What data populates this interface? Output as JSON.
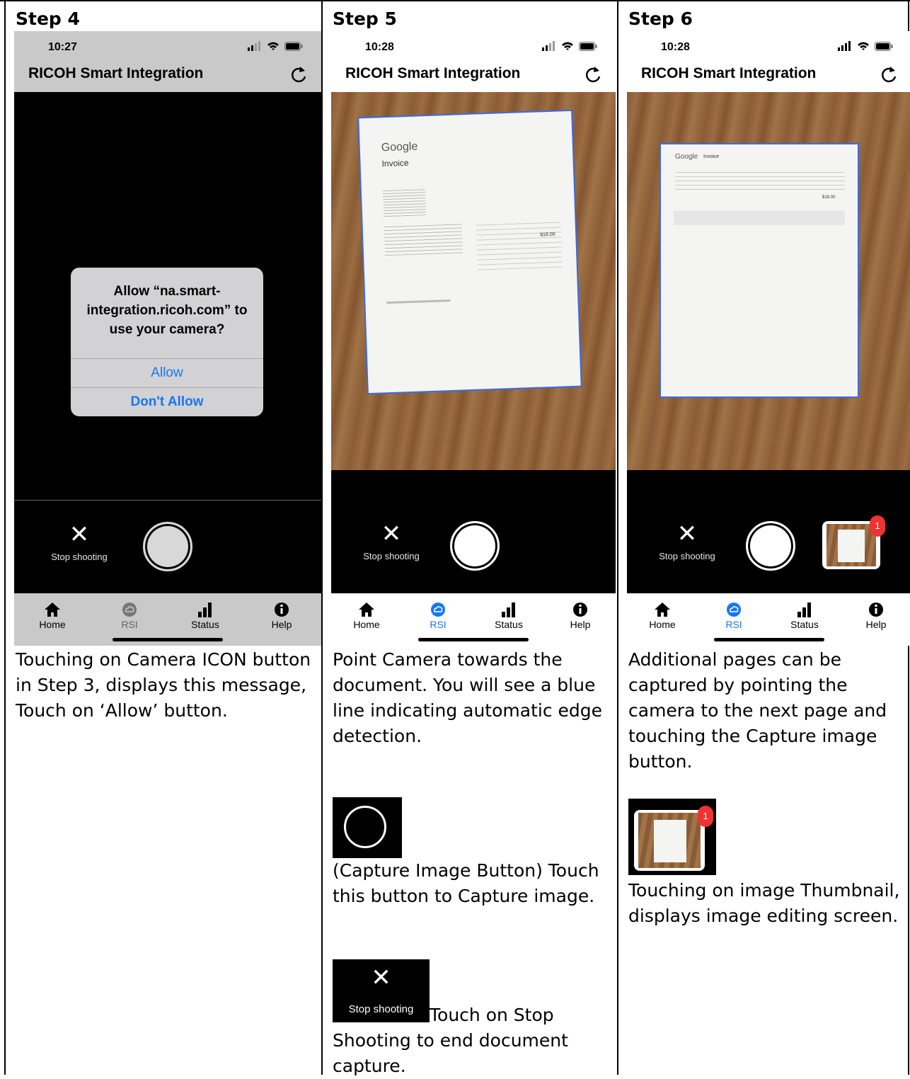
{
  "steps": [
    {
      "heading": "Step 4",
      "time": "10:27",
      "app_title": "RICOH Smart Integration",
      "dialog": {
        "message": "Allow “na.smart-integration.ricoh.com” to use your camera?",
        "allow_label": "Allow",
        "deny_label": "Don't Allow"
      },
      "stop_label": "Stop shooting",
      "tabs": [
        "Home",
        "RSI",
        "Status",
        "Help"
      ],
      "description": "Touching on Camera ICON button in Step 3, displays this message, Touch on ‘Allow’ button."
    },
    {
      "heading": "Step 5",
      "time": "10:28",
      "app_title": "RICOH Smart Integration",
      "document": {
        "brand": "Google",
        "title": "Invoice",
        "total": "$18.00"
      },
      "stop_label": "Stop shooting",
      "tabs": [
        "Home",
        "RSI",
        "Status",
        "Help"
      ],
      "description": "Point Camera towards the document. You will see a blue line indicating automatic edge detection.",
      "capture_caption": "(Capture Image Button) Touch this button to Capture image.",
      "stop_caption": "Touch on Stop Shooting to end document capture."
    },
    {
      "heading": "Step 6",
      "time": "10:28",
      "app_title": "RICOH Smart Integration",
      "document": {
        "brand": "Google",
        "title": "Invoice",
        "total": "$18.00"
      },
      "stop_label": "Stop shooting",
      "tabs": [
        "Home",
        "RSI",
        "Status",
        "Help"
      ],
      "badge": "1",
      "description": "Additional pages can be captured by pointing the camera to the next page and touching the Capture image button.",
      "thumb_caption": "Touching on image Thumbnail, displays image editing screen."
    }
  ],
  "colors": {
    "accent": "#1877f2",
    "edge": "#3a6be0",
    "badge": "#e33333"
  }
}
